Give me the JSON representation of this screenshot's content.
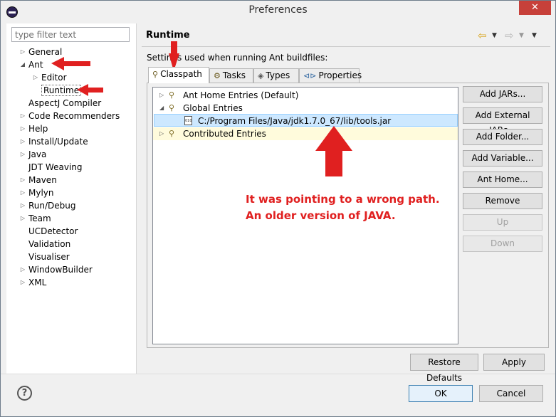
{
  "window": {
    "title": "Preferences",
    "close_glyph": "✕"
  },
  "left": {
    "filter_placeholder": "type filter text",
    "items": [
      {
        "label": "General",
        "expander": "▷"
      },
      {
        "label": "Ant",
        "expander": "◢"
      },
      {
        "label": "Editor",
        "expander": "▷"
      },
      {
        "label": "Runtime",
        "expander": ""
      },
      {
        "label": "AspectJ Compiler",
        "expander": ""
      },
      {
        "label": "Code Recommenders",
        "expander": "▷"
      },
      {
        "label": "Help",
        "expander": "▷"
      },
      {
        "label": "Install/Update",
        "expander": "▷"
      },
      {
        "label": "Java",
        "expander": "▷"
      },
      {
        "label": "JDT Weaving",
        "expander": ""
      },
      {
        "label": "Maven",
        "expander": "▷"
      },
      {
        "label": "Mylyn",
        "expander": "▷"
      },
      {
        "label": "Run/Debug",
        "expander": "▷"
      },
      {
        "label": "Team",
        "expander": "▷"
      },
      {
        "label": "UCDetector",
        "expander": ""
      },
      {
        "label": "Validation",
        "expander": ""
      },
      {
        "label": "Visualiser",
        "expander": ""
      },
      {
        "label": "WindowBuilder",
        "expander": "▷"
      },
      {
        "label": "XML",
        "expander": "▷"
      }
    ]
  },
  "right": {
    "title": "Runtime",
    "description": "Settings used when running Ant buildfiles:",
    "tabs": [
      {
        "label": "Classpath",
        "icon": "classpath-icon"
      },
      {
        "label": "Tasks",
        "icon": "tasks-icon"
      },
      {
        "label": "Types",
        "icon": "types-icon"
      },
      {
        "label": "Properties",
        "icon": "properties-icon"
      }
    ],
    "classpath": {
      "entries": [
        {
          "label": "Ant Home Entries (Default)",
          "expander": "▷"
        },
        {
          "label": "Global Entries",
          "expander": "◢"
        },
        {
          "label": "C:/Program Files/Java/jdk1.7.0_67/lib/tools.jar",
          "expander": ""
        },
        {
          "label": "Contributed Entries",
          "expander": "▷"
        }
      ]
    },
    "buttons": {
      "add_jars": "Add JARs...",
      "add_external_jars": "Add External JARs...",
      "add_folder": "Add Folder...",
      "add_variable": "Add Variable...",
      "ant_home": "Ant Home...",
      "remove": "Remove",
      "up": "Up",
      "down": "Down"
    },
    "restore_defaults": "Restore Defaults",
    "apply": "Apply"
  },
  "footer": {
    "help": "?",
    "ok": "OK",
    "cancel": "Cancel"
  },
  "annotation": {
    "line1": "It was pointing to a wrong path.",
    "line2": "An older version of JAVA.",
    "color": "#e02020"
  }
}
